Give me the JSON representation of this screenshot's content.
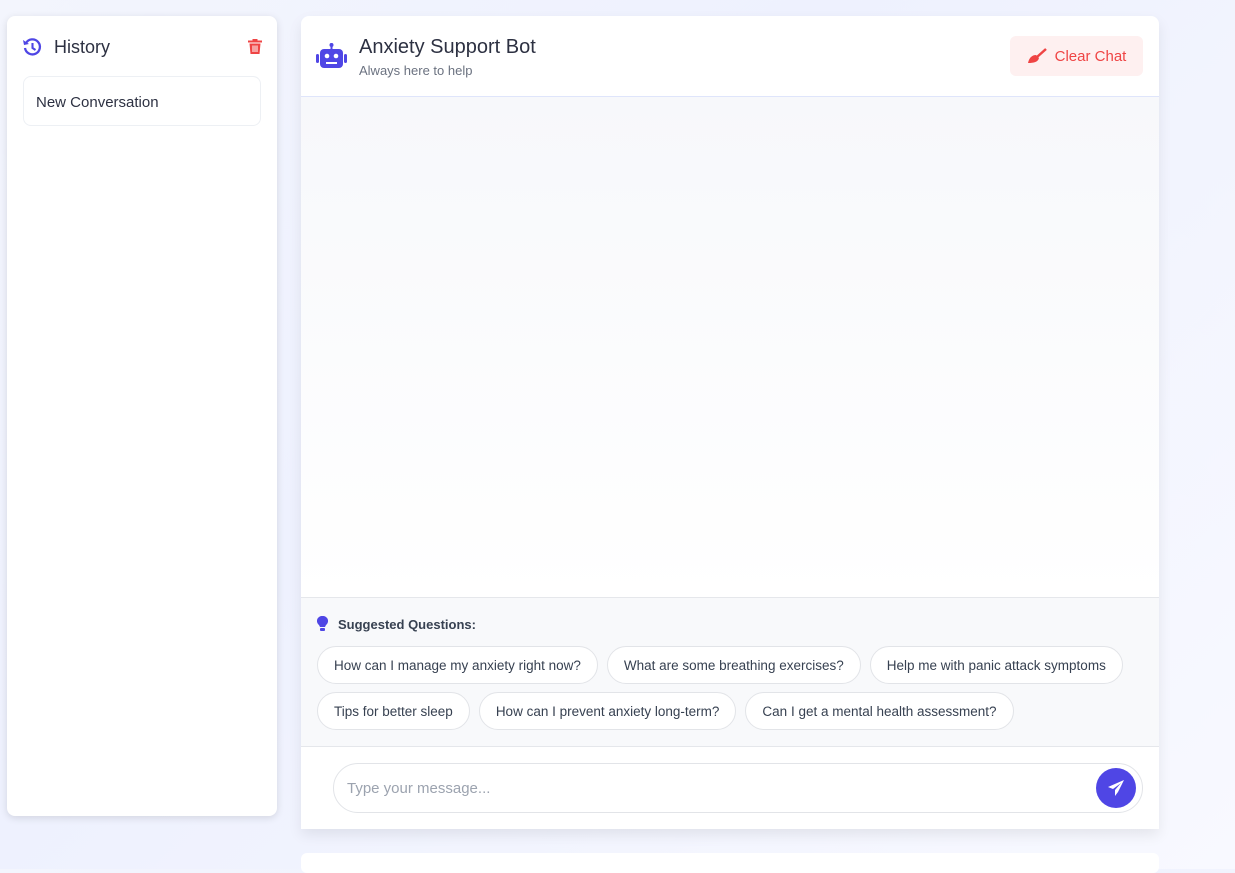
{
  "sidebar": {
    "title": "History",
    "conversations": [
      {
        "label": "New Conversation"
      }
    ]
  },
  "header": {
    "title": "Anxiety Support Bot",
    "subtitle": "Always here to help",
    "clear_label": "Clear Chat"
  },
  "suggestions": {
    "title": "Suggested Questions:",
    "items": [
      "How can I manage my anxiety right now?",
      "What are some breathing exercises?",
      "Help me with panic attack symptoms",
      "Tips for better sleep",
      "How can I prevent anxiety long-term?",
      "Can I get a mental health assessment?"
    ]
  },
  "composer": {
    "placeholder": "Type your message...",
    "value": ""
  },
  "colors": {
    "accent": "#4f46e5",
    "danger": "#ef4444"
  }
}
